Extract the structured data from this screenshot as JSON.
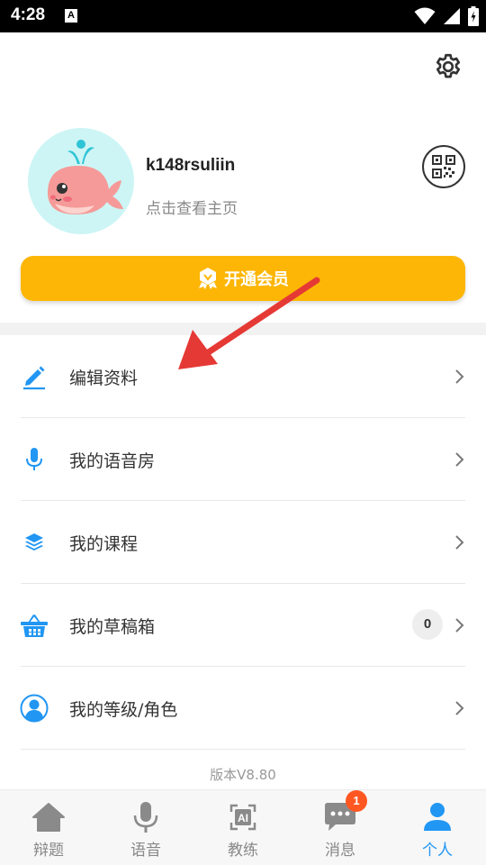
{
  "status_bar": {
    "time": "4:28",
    "notification_glyph": "A"
  },
  "profile": {
    "username": "k148rsuliin",
    "homepage_link": "点击查看主页"
  },
  "vip": {
    "label": "开通会员"
  },
  "menu": [
    {
      "label": "编辑资料",
      "icon": "pencil-icon"
    },
    {
      "label": "我的语音房",
      "icon": "microphone-icon"
    },
    {
      "label": "我的课程",
      "icon": "layers-icon"
    },
    {
      "label": "我的草稿箱",
      "icon": "basket-icon",
      "badge": "0"
    },
    {
      "label": "我的等级/角色",
      "icon": "user-circle-icon"
    }
  ],
  "version": "版本V8.80",
  "bottom_nav": [
    {
      "label": "辩题",
      "icon": "home-icon",
      "active": false
    },
    {
      "label": "语音",
      "icon": "microphone-icon",
      "active": false
    },
    {
      "label": "教练",
      "icon": "ai-coach-icon",
      "active": false,
      "icon_text": "AI"
    },
    {
      "label": "消息",
      "icon": "chat-icon",
      "active": false,
      "badge": "1"
    },
    {
      "label": "个人",
      "icon": "person-icon",
      "active": true
    }
  ],
  "colors": {
    "accent": "#2196f3",
    "vip": "#fdb605",
    "arrow": "#e53935",
    "badge": "#ff5722"
  }
}
